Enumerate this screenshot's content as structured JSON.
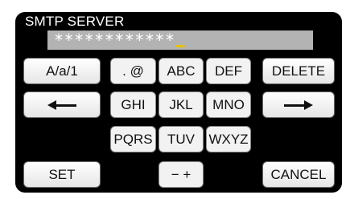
{
  "screen": {
    "title": "SMTP SERVER",
    "field_value": "************"
  },
  "keys": {
    "mode": "A/a/1",
    "symbols": ". @",
    "abc": "ABC",
    "def": "DEF",
    "delete": "DELETE",
    "ghi": "GHI",
    "jkl": "JKL",
    "mno": "MNO",
    "pqrs": "PQRS",
    "tuv": "TUV",
    "wxyz": "WXYZ",
    "set": "SET",
    "minus_plus": "− +",
    "cancel": "CANCEL"
  },
  "icons": {
    "cursor_left": "arrow-left-icon",
    "cursor_right": "arrow-right-icon"
  },
  "colors": {
    "screen_bg": "#000000",
    "field_bg": "#b3b3b3",
    "cursor": "#e6c100",
    "key_bg": "#ffffff"
  }
}
